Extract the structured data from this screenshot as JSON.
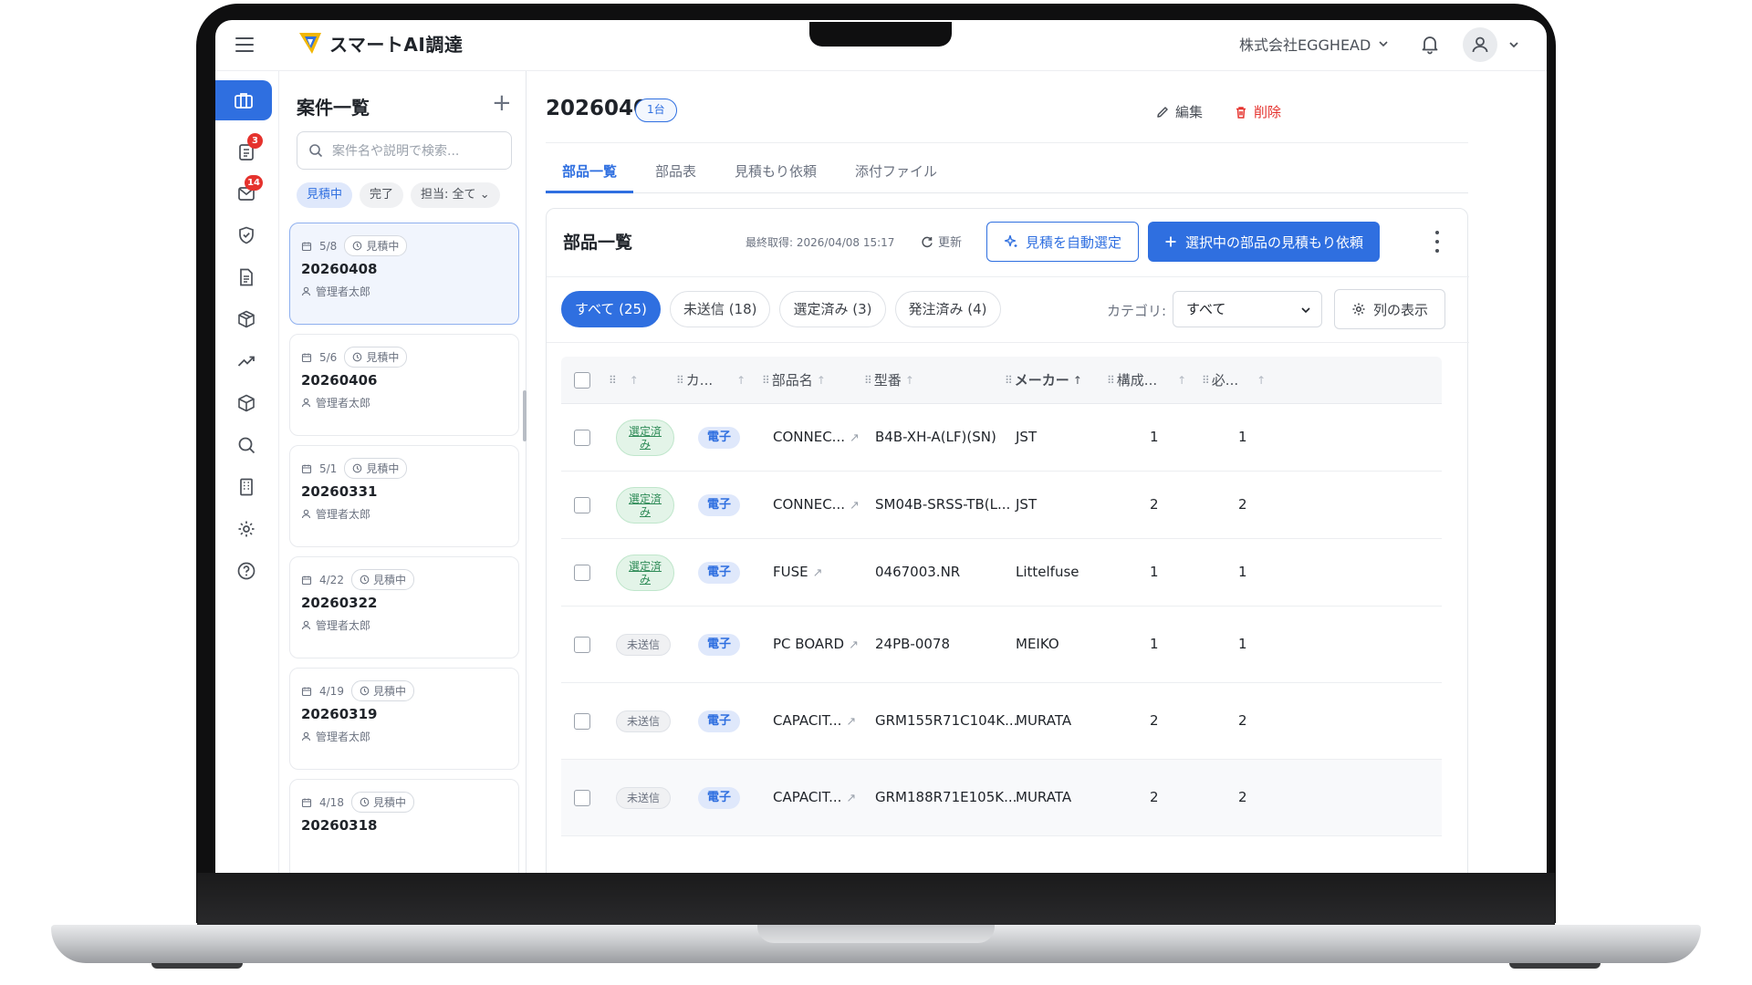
{
  "app": {
    "name": "スマートAI調達"
  },
  "header": {
    "company": "株式会社EGGHEAD"
  },
  "rail": {
    "items": [
      {
        "icon": "briefcase-icon",
        "active": true,
        "badge": ""
      },
      {
        "icon": "clipboard-icon",
        "active": false,
        "badge": "3"
      },
      {
        "icon": "mail-icon",
        "active": false,
        "badge": "14"
      },
      {
        "icon": "shield-icon",
        "active": false,
        "badge": ""
      },
      {
        "icon": "document-icon",
        "active": false,
        "badge": ""
      },
      {
        "icon": "package-icon",
        "active": false,
        "badge": ""
      },
      {
        "icon": "trend-icon",
        "active": false,
        "badge": ""
      },
      {
        "icon": "box-icon",
        "active": false,
        "badge": ""
      },
      {
        "icon": "search-icon",
        "active": false,
        "badge": ""
      },
      {
        "icon": "building-icon",
        "active": false,
        "badge": ""
      },
      {
        "icon": "gear-icon",
        "active": false,
        "badge": ""
      },
      {
        "icon": "help-icon",
        "active": false,
        "badge": ""
      }
    ]
  },
  "projects": {
    "title": "案件一覧",
    "add_label": "+",
    "search_placeholder": "案件名や説明で検索...",
    "filters": {
      "estimating": "見積中",
      "done": "完了",
      "owner": "担当: 全て"
    },
    "cards": [
      {
        "date": "5/8",
        "status": "見積中",
        "id": "20260408",
        "user": "管理者太郎"
      },
      {
        "date": "5/6",
        "status": "見積中",
        "id": "20260406",
        "user": "管理者太郎"
      },
      {
        "date": "5/1",
        "status": "見積中",
        "id": "20260331",
        "user": "管理者太郎"
      },
      {
        "date": "4/22",
        "status": "見積中",
        "id": "20260322",
        "user": "管理者太郎"
      },
      {
        "date": "4/19",
        "status": "見積中",
        "id": "20260319",
        "user": "管理者太郎"
      },
      {
        "date": "4/18",
        "status": "見積中",
        "id": "20260318",
        "user": ""
      }
    ]
  },
  "detail": {
    "title": "20260408",
    "qty": "1台",
    "edit": "編集",
    "delete": "削除",
    "tabs": [
      "部品一覧",
      "部品表",
      "見積もり依頼",
      "添付ファイル"
    ]
  },
  "parts": {
    "title": "部品一覧",
    "fetched": "最終取得: 2026/04/08 15:17",
    "refresh": "更新",
    "auto_select": "見積を自動選定",
    "request": "選択中の部品の見積もり依頼",
    "status_filters": [
      "すべて (25)",
      "未送信 (18)",
      "選定済み (3)",
      "発注済み (4)"
    ],
    "category_label": "カテゴリ:",
    "category_value": "すべて",
    "columns_button": "列の表示",
    "headers": {
      "category": "カ...",
      "name": "部品名",
      "model": "型番",
      "maker": "メーカー",
      "composition": "構成...",
      "required": "必..."
    },
    "rows": [
      {
        "status": "選定済み",
        "status_type": "sel",
        "category": "電子",
        "name": "CONNEC...",
        "model": "B4B-XH-A(LF)(SN)",
        "maker": "JST",
        "composition": "1",
        "required": "1"
      },
      {
        "status": "選定済み",
        "status_type": "sel",
        "category": "電子",
        "name": "CONNEC...",
        "model": "SM04B-SRSS-TB(L...",
        "maker": "JST",
        "composition": "2",
        "required": "2"
      },
      {
        "status": "選定済み",
        "status_type": "sel",
        "category": "電子",
        "name": "FUSE",
        "model": "0467003.NR",
        "maker": "Littelfuse",
        "composition": "1",
        "required": "1"
      },
      {
        "status": "未送信",
        "status_type": "unsent",
        "category": "電子",
        "name": "PC BOARD",
        "model": "24PB-0078",
        "maker": "MEIKO",
        "composition": "1",
        "required": "1"
      },
      {
        "status": "未送信",
        "status_type": "unsent",
        "category": "電子",
        "name": "CAPACIT...",
        "model": "GRM155R71C104K...",
        "maker": "MURATA",
        "composition": "2",
        "required": "2"
      },
      {
        "status": "未送信",
        "status_type": "unsent",
        "category": "電子",
        "name": "CAPACIT...",
        "model": "GRM188R71E105K...",
        "maker": "MURATA",
        "composition": "2",
        "required": "2"
      }
    ]
  },
  "colors": {
    "accent": "#2f6fe0",
    "danger": "#e5322d",
    "selected": "#2e8b57"
  }
}
